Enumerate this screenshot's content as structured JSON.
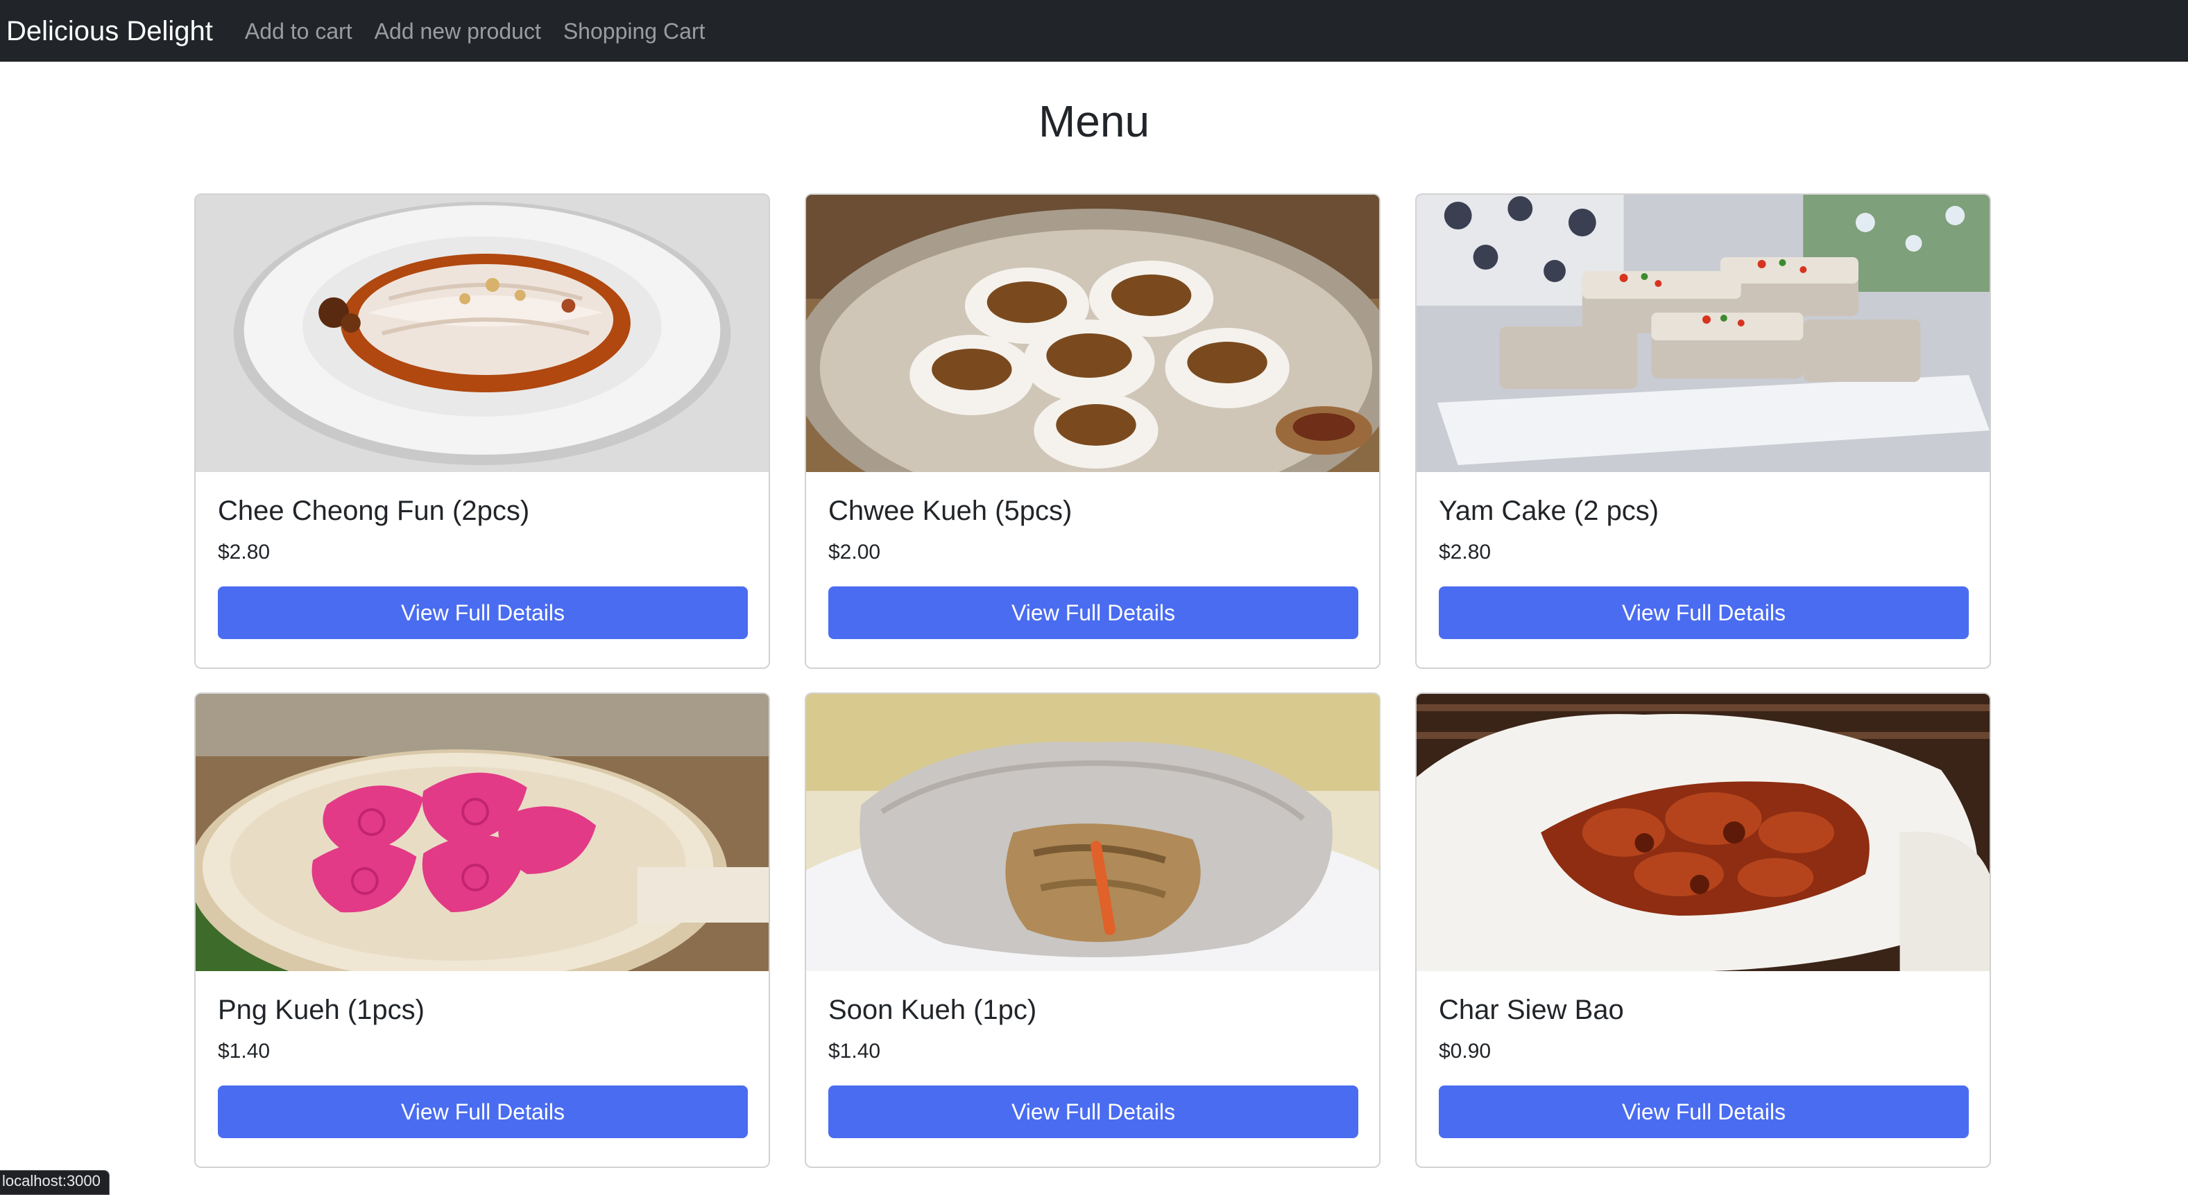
{
  "navbar": {
    "brand": "Delicious Delight",
    "links": [
      "Add to cart",
      "Add new product",
      "Shopping Cart"
    ]
  },
  "page": {
    "title": "Menu"
  },
  "products": [
    {
      "name": "Chee Cheong Fun (2pcs)",
      "price": "$2.80",
      "button": "View Full Details",
      "image": "chee-cheong-fun"
    },
    {
      "name": "Chwee Kueh (5pcs)",
      "price": "$2.00",
      "button": "View Full Details",
      "image": "chwee-kueh"
    },
    {
      "name": "Yam Cake (2 pcs)",
      "price": "$2.80",
      "button": "View Full Details",
      "image": "yam-cake"
    },
    {
      "name": "Png Kueh (1pcs)",
      "price": "$1.40",
      "button": "View Full Details",
      "image": "png-kueh"
    },
    {
      "name": "Soon Kueh (1pc)",
      "price": "$1.40",
      "button": "View Full Details",
      "image": "soon-kueh"
    },
    {
      "name": "Char Siew Bao",
      "price": "$0.90",
      "button": "View Full Details",
      "image": "char-siew-bao"
    }
  ],
  "status_bar": {
    "url": "localhost:3000"
  },
  "colors": {
    "navbar_bg": "#212529",
    "button_primary": "#4a6cf0",
    "text": "#212529"
  }
}
